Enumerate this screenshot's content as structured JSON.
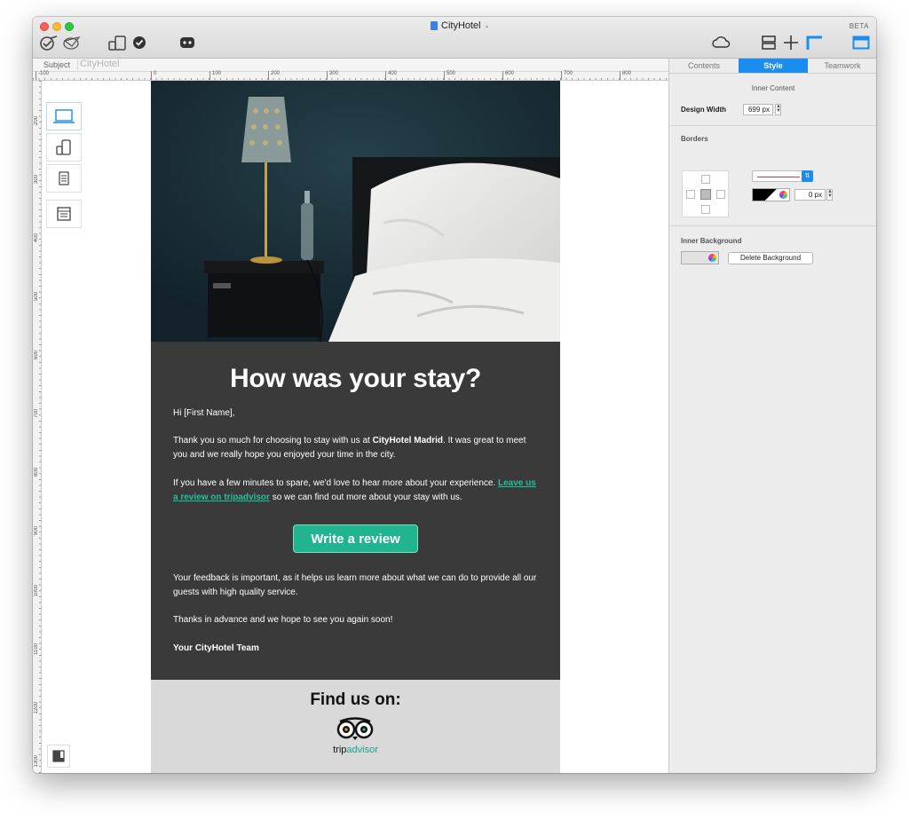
{
  "window": {
    "title": "CityHotel",
    "badge": "BETA"
  },
  "toolbar": {
    "left_icons": [
      "preview-icon",
      "send-icon",
      "devices-icon",
      "check-icon",
      "gamepad-icon"
    ],
    "right_icons": [
      "cloud-icon",
      "layout-icon",
      "move-icon",
      "corner-icon",
      "panel-toggle-icon"
    ]
  },
  "subject": {
    "label": "Subject",
    "value": "CityHotel"
  },
  "ruler": {
    "h_labels": [
      "-100",
      "0",
      "100",
      "200",
      "300",
      "400",
      "500",
      "600",
      "700",
      "800"
    ],
    "v_labels": [
      "200",
      "300",
      "400",
      "500",
      "600",
      "700",
      "800",
      "900",
      "1000",
      "1100",
      "1200",
      "1300"
    ]
  },
  "device_buttons": [
    "laptop-icon",
    "mobile-devices-icon",
    "tablet-icon",
    "template-icon"
  ],
  "email": {
    "headline": "How was your stay?",
    "greeting": "Hi [First Name],",
    "para1_a": "Thank you so much for choosing to stay with us at ",
    "para1_bold": "CityHotel Madrid",
    "para1_b": ". It was great to meet you and we really hope you enjoyed your time in the city.",
    "para2_a": "If you have a few minutes to spare, we'd love to hear more about your experience. ",
    "para2_link": "Leave us a review on tripadvisor",
    "para2_b": " so we can find out more about your stay with us.",
    "cta": "Write a review",
    "para3": "Your feedback is important, as it helps us learn more about what we can do to provide all our guests with high quality service.",
    "para4": "Thanks in advance and we hope to see you again soon!",
    "signature": "Your CityHotel Team",
    "footer_title": "Find us on:",
    "ta_trip": "trip",
    "ta_advisor": "advisor"
  },
  "panel": {
    "tabs": [
      "Contents",
      "Style",
      "Teamwork"
    ],
    "active_tab": "Style",
    "inner_content_title": "Inner Content",
    "design_width_label": "Design Width",
    "design_width_value": "699 px",
    "borders_title": "Borders",
    "border_width_value": "0 px",
    "inner_background_title": "Inner Background",
    "delete_background_label": "Delete Background"
  },
  "colors": {
    "accent": "#1b8cf0",
    "brand_green": "#20b58f",
    "content_bg": "#3a3a3a",
    "footer_bg": "#d9d9d9",
    "link": "#1ec39b"
  }
}
